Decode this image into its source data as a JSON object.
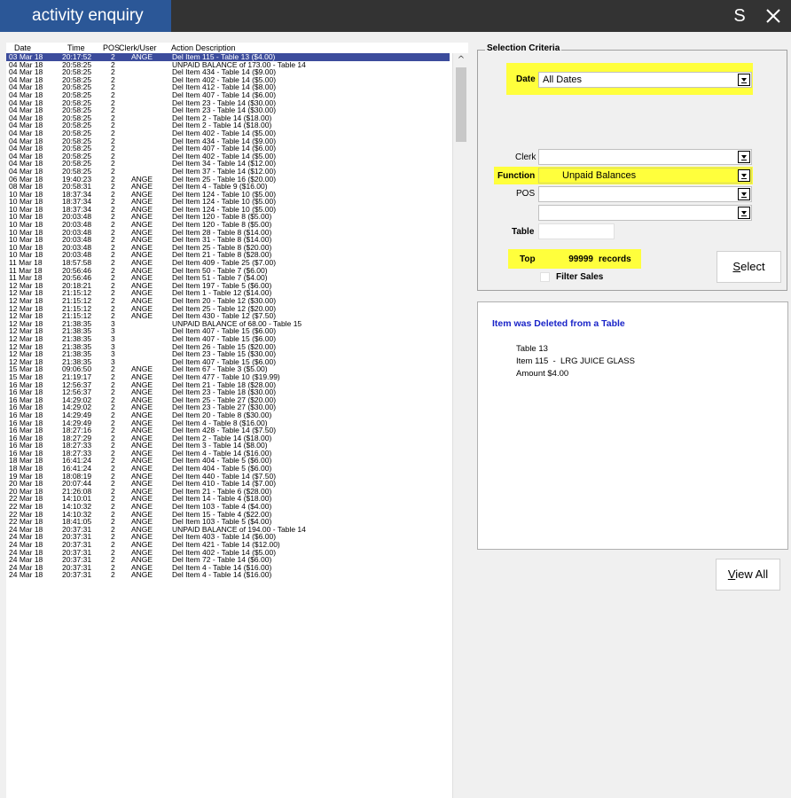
{
  "window": {
    "title": "activity enquiry",
    "s_button": "S"
  },
  "list": {
    "headers": {
      "date": "Date",
      "time": "Time",
      "pos": "POS",
      "clerk": "Clerk/User",
      "desc": "Action Description"
    },
    "selected_index": 0,
    "rows": [
      [
        "03 Mar 18",
        "20:17:52",
        "2",
        "ANGE",
        "Del Item 115 - Table 13 ($4.00)"
      ],
      [
        "04 Mar 18",
        "20:58:25",
        "2",
        "",
        "UNPAID BALANCE of 173.00 - Table 14"
      ],
      [
        "04 Mar 18",
        "20:58:25",
        "2",
        "",
        "Del Item 434 - Table 14 ($9.00)"
      ],
      [
        "04 Mar 18",
        "20:58:25",
        "2",
        "",
        "Del Item 402 - Table 14 ($5.00)"
      ],
      [
        "04 Mar 18",
        "20:58:25",
        "2",
        "",
        "Del Item 412 - Table 14 ($8.00)"
      ],
      [
        "04 Mar 18",
        "20:58:25",
        "2",
        "",
        "Del Item 407 - Table 14 ($6.00)"
      ],
      [
        "04 Mar 18",
        "20:58:25",
        "2",
        "",
        "Del Item 23 - Table 14 ($30.00)"
      ],
      [
        "04 Mar 18",
        "20:58:25",
        "2",
        "",
        "Del Item 23 - Table 14 ($30.00)"
      ],
      [
        "04 Mar 18",
        "20:58:25",
        "2",
        "",
        "Del Item 2 - Table 14 ($18.00)"
      ],
      [
        "04 Mar 18",
        "20:58:25",
        "2",
        "",
        "Del Item 2 - Table 14 ($18.00)"
      ],
      [
        "04 Mar 18",
        "20:58:25",
        "2",
        "",
        "Del Item 402 - Table 14 ($5.00)"
      ],
      [
        "04 Mar 18",
        "20:58:25",
        "2",
        "",
        "Del Item 434 - Table 14 ($9.00)"
      ],
      [
        "04 Mar 18",
        "20:58:25",
        "2",
        "",
        "Del Item 407 - Table 14 ($6.00)"
      ],
      [
        "04 Mar 18",
        "20:58:25",
        "2",
        "",
        "Del Item 402 - Table 14 ($5.00)"
      ],
      [
        "04 Mar 18",
        "20:58:25",
        "2",
        "",
        "Del Item 34 - Table 14 ($12.00)"
      ],
      [
        "04 Mar 18",
        "20:58:25",
        "2",
        "",
        "Del Item 37 - Table 14 ($12.00)"
      ],
      [
        "06 Mar 18",
        "19:40:23",
        "2",
        "ANGE",
        "Del Item 25 - Table 16 ($20.00)"
      ],
      [
        "08 Mar 18",
        "20:58:31",
        "2",
        "ANGE",
        "Del Item 4 - Table 9 ($16.00)"
      ],
      [
        "10 Mar 18",
        "18:37:34",
        "2",
        "ANGE",
        "Del Item 124 - Table 10 ($5.00)"
      ],
      [
        "10 Mar 18",
        "18:37:34",
        "2",
        "ANGE",
        "Del Item 124 - Table 10 ($5.00)"
      ],
      [
        "10 Mar 18",
        "18:37:34",
        "2",
        "ANGE",
        "Del Item 124 - Table 10 ($5.00)"
      ],
      [
        "10 Mar 18",
        "20:03:48",
        "2",
        "ANGE",
        "Del Item 120 - Table 8 ($5.00)"
      ],
      [
        "10 Mar 18",
        "20:03:48",
        "2",
        "ANGE",
        "Del Item 120 - Table 8 ($5.00)"
      ],
      [
        "10 Mar 18",
        "20:03:48",
        "2",
        "ANGE",
        "Del Item 28 - Table 8 ($14.00)"
      ],
      [
        "10 Mar 18",
        "20:03:48",
        "2",
        "ANGE",
        "Del Item 31 - Table 8 ($14.00)"
      ],
      [
        "10 Mar 18",
        "20:03:48",
        "2",
        "ANGE",
        "Del Item 25 - Table 8 ($20.00)"
      ],
      [
        "10 Mar 18",
        "20:03:48",
        "2",
        "ANGE",
        "Del Item 21 - Table 8 ($28.00)"
      ],
      [
        "11 Mar 18",
        "18:57:58",
        "2",
        "ANGE",
        "Del Item 409 - Table 25 ($7.00)"
      ],
      [
        "11 Mar 18",
        "20:56:46",
        "2",
        "ANGE",
        "Del Item 50 - Table 7 ($6.00)"
      ],
      [
        "11 Mar 18",
        "20:56:46",
        "2",
        "ANGE",
        "Del Item 51 - Table 7 ($4.00)"
      ],
      [
        "12 Mar 18",
        "20:18:21",
        "2",
        "ANGE",
        "Del Item 197 - Table 5 ($6.00)"
      ],
      [
        "12 Mar 18",
        "21:15:12",
        "2",
        "ANGE",
        "Del Item 1 - Table 12 ($14.00)"
      ],
      [
        "12 Mar 18",
        "21:15:12",
        "2",
        "ANGE",
        "Del Item 20 - Table 12 ($30.00)"
      ],
      [
        "12 Mar 18",
        "21:15:12",
        "2",
        "ANGE",
        "Del Item 25 - Table 12 ($20.00)"
      ],
      [
        "12 Mar 18",
        "21:15:12",
        "2",
        "ANGE",
        "Del Item 430 - Table 12 ($7.50)"
      ],
      [
        "12 Mar 18",
        "21:38:35",
        "3",
        "",
        "UNPAID BALANCE of 68.00 - Table 15"
      ],
      [
        "12 Mar 18",
        "21:38:35",
        "3",
        "",
        "Del Item 407 - Table 15 ($6.00)"
      ],
      [
        "12 Mar 18",
        "21:38:35",
        "3",
        "",
        "Del Item 407 - Table 15 ($6.00)"
      ],
      [
        "12 Mar 18",
        "21:38:35",
        "3",
        "",
        "Del Item 26 - Table 15 ($20.00)"
      ],
      [
        "12 Mar 18",
        "21:38:35",
        "3",
        "",
        "Del Item 23 - Table 15 ($30.00)"
      ],
      [
        "12 Mar 18",
        "21:38:35",
        "3",
        "",
        "Del Item 407 - Table 15 ($6.00)"
      ],
      [
        "15 Mar 18",
        "09:06:50",
        "2",
        "ANGE",
        "Del Item 67 - Table 3 ($5.00)"
      ],
      [
        "15 Mar 18",
        "21:19:17",
        "2",
        "ANGE",
        "Del Item 477 - Table 10 ($19.99)"
      ],
      [
        "16 Mar 18",
        "12:56:37",
        "2",
        "ANGE",
        "Del Item 21 - Table 18 ($28.00)"
      ],
      [
        "16 Mar 18",
        "12:56:37",
        "2",
        "ANGE",
        "Del Item 23 - Table 18 ($30.00)"
      ],
      [
        "16 Mar 18",
        "14:29:02",
        "2",
        "ANGE",
        "Del Item 25 - Table 27 ($20.00)"
      ],
      [
        "16 Mar 18",
        "14:29:02",
        "2",
        "ANGE",
        "Del Item 23 - Table 27 ($30.00)"
      ],
      [
        "16 Mar 18",
        "14:29:49",
        "2",
        "ANGE",
        "Del Item 20 - Table 8 ($30.00)"
      ],
      [
        "16 Mar 18",
        "14:29:49",
        "2",
        "ANGE",
        "Del Item 4 - Table 8 ($16.00)"
      ],
      [
        "16 Mar 18",
        "18:27:16",
        "2",
        "ANGE",
        "Del Item 428 - Table 14 ($7.50)"
      ],
      [
        "16 Mar 18",
        "18:27:29",
        "2",
        "ANGE",
        "Del Item 2 - Table 14 ($18.00)"
      ],
      [
        "16 Mar 18",
        "18:27:33",
        "2",
        "ANGE",
        "Del Item 3 - Table 14 ($8.00)"
      ],
      [
        "16 Mar 18",
        "18:27:33",
        "2",
        "ANGE",
        "Del Item 4 - Table 14 ($16.00)"
      ],
      [
        "18 Mar 18",
        "16:41:24",
        "2",
        "ANGE",
        "Del Item 404 - Table 5 ($6.00)"
      ],
      [
        "18 Mar 18",
        "16:41:24",
        "2",
        "ANGE",
        "Del Item 404 - Table 5 ($6.00)"
      ],
      [
        "19 Mar 18",
        "18:08:19",
        "2",
        "ANGE",
        "Del Item 440 - Table 14 ($7.50)"
      ],
      [
        "20 Mar 18",
        "20:07:44",
        "2",
        "ANGE",
        "Del Item 410 - Table 14 ($7.00)"
      ],
      [
        "20 Mar 18",
        "21:26:08",
        "2",
        "ANGE",
        "Del Item 21 - Table 6 ($28.00)"
      ],
      [
        "22 Mar 18",
        "14:10:01",
        "2",
        "ANGE",
        "Del Item 14 - Table 4 ($18.00)"
      ],
      [
        "22 Mar 18",
        "14:10:32",
        "2",
        "ANGE",
        "Del Item 103 - Table 4 ($4.00)"
      ],
      [
        "22 Mar 18",
        "14:10:32",
        "2",
        "ANGE",
        "Del Item 15 - Table 4 ($22.00)"
      ],
      [
        "22 Mar 18",
        "18:41:05",
        "2",
        "ANGE",
        "Del Item 103 - Table 5 ($4.00)"
      ],
      [
        "24 Mar 18",
        "20:37:31",
        "2",
        "ANGE",
        "UNPAID BALANCE of 194.00 - Table 14"
      ],
      [
        "24 Mar 18",
        "20:37:31",
        "2",
        "ANGE",
        "Del Item 403 - Table 14 ($6.00)"
      ],
      [
        "24 Mar 18",
        "20:37:31",
        "2",
        "ANGE",
        "Del Item 421 - Table 14 ($12.00)"
      ],
      [
        "24 Mar 18",
        "20:37:31",
        "2",
        "ANGE",
        "Del Item 402 - Table 14 ($5.00)"
      ],
      [
        "24 Mar 18",
        "20:37:31",
        "2",
        "ANGE",
        "Del Item 72 - Table 14 ($6.00)"
      ],
      [
        "24 Mar 18",
        "20:37:31",
        "2",
        "ANGE",
        "Del Item 4 - Table 14 ($16.00)"
      ],
      [
        "24 Mar 18",
        "20:37:31",
        "2",
        "ANGE",
        "Del Item 4 - Table 14 ($16.00)"
      ]
    ]
  },
  "criteria": {
    "legend": "Selection Criteria",
    "date_label": "Date",
    "date_value": "All Dates",
    "clerk_label": "Clerk",
    "clerk_value": "",
    "function_label": "Function",
    "function_value": "Unpaid Balances",
    "pos_label": "POS",
    "pos_value": "",
    "pos2_value": "",
    "table_label": "Table",
    "table_value": "",
    "top_label": "Top",
    "top_value": "99999",
    "records_label": "records",
    "filter_sales_label": "Filter Sales",
    "select_button_rest": "elect",
    "select_button_key": "S"
  },
  "detail": {
    "title": "Item was Deleted from a Table",
    "line1": "Table 13",
    "line2": "Item 115  -  LRG JUICE GLASS",
    "line3": "Amount $4.00"
  },
  "view_all": {
    "key": "V",
    "rest": "iew All"
  },
  "colors": {
    "title_tab": "#2b5797",
    "titlebar": "#333333",
    "selection": "#3c4c9c",
    "highlight": "#ffff3c",
    "detail_title": "#1a24c8"
  }
}
